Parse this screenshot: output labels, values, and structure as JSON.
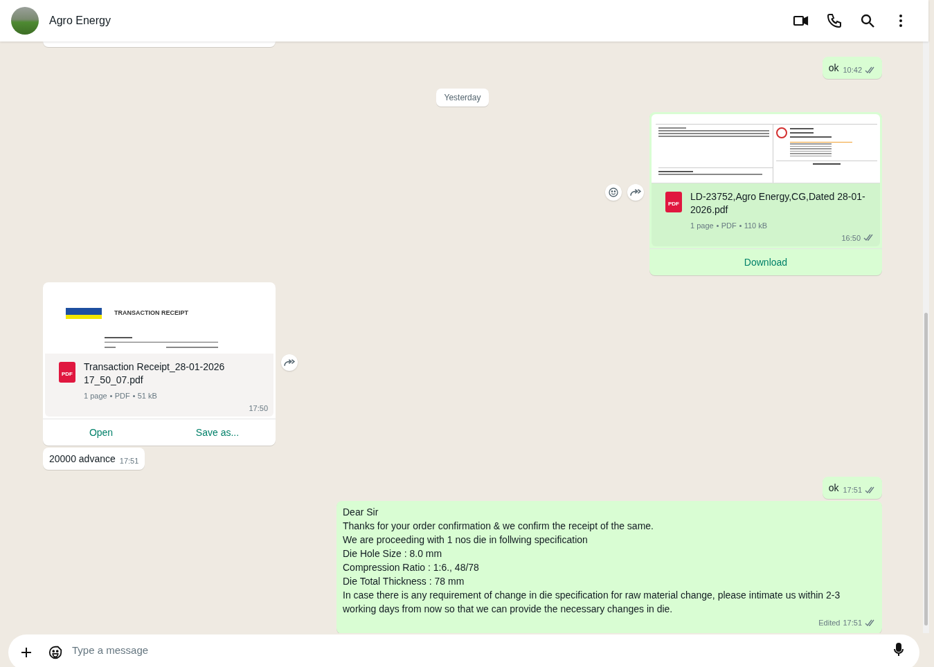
{
  "header": {
    "title": "Agro Energy"
  },
  "messages": [
    {
      "kind": "clipped",
      "outgoing": false
    },
    {
      "kind": "text",
      "outgoing": true,
      "text": "ok",
      "time": "10:42",
      "read": false
    },
    {
      "kind": "date",
      "text": "Yesterday"
    },
    {
      "kind": "document",
      "outgoing": true,
      "preview": {
        "kind": "invoice"
      },
      "icon_label": "PDF",
      "filename": "LD-23752,Agro Energy,CG,Dated 28-01-2026.pdf",
      "meta": [
        "1 page",
        "PDF",
        "110 kB"
      ],
      "time": "16:50",
      "read": false,
      "actions": [
        "Download"
      ]
    },
    {
      "kind": "document",
      "outgoing": false,
      "preview": {
        "kind": "receipt",
        "title": "TRANSACTION RECEIPT"
      },
      "icon_label": "PDF",
      "filename": "Transaction Receipt_28-01-2026 17_50_07.pdf",
      "meta": [
        "1 page",
        "PDF",
        "51 kB"
      ],
      "time": "17:50",
      "actions": [
        "Open",
        "Save as..."
      ]
    },
    {
      "kind": "text",
      "outgoing": false,
      "text": "20000 advance",
      "time": "17:51"
    },
    {
      "kind": "text",
      "outgoing": true,
      "text": "ok",
      "time": "17:51",
      "read": false
    },
    {
      "kind": "text",
      "outgoing": true,
      "lines": [
        "Dear Sir",
        "Thanks for your order confirmation & we confirm the receipt of the same.",
        "We are proceeding with 1 nos die in follwing specification",
        "Die Hole Size : 8.0 mm",
        "Compression Ratio : 1:6., 48/78",
        "Die Total Thickness : 78 mm",
        "In case there is any requirement of change in die specification for raw material change, please intimate us within 2-3 working days from now so that we can provide the necessary changes in die."
      ],
      "edited": "Edited",
      "time": "17:51",
      "read": false
    }
  ],
  "composer": {
    "placeholder": "Type a message"
  }
}
